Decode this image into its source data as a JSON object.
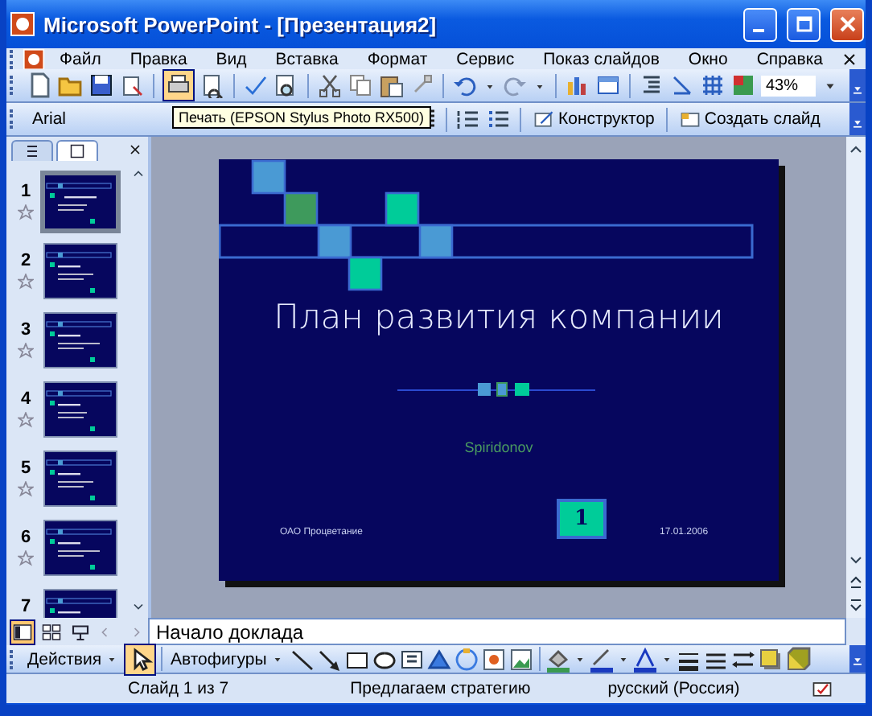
{
  "window": {
    "title": "Microsoft PowerPoint - [Презентация2]"
  },
  "menu": {
    "items": [
      "Файл",
      "Правка",
      "Вид",
      "Вставка",
      "Формат",
      "Сервис",
      "Показ слайдов",
      "Окно",
      "Справка"
    ]
  },
  "standard_toolbar": {
    "print_button": {
      "highlighted": true
    },
    "zoom": "43%"
  },
  "formatting_toolbar": {
    "font": "Arial",
    "buttons": [
      "Конструктор",
      "Создать слайд"
    ]
  },
  "tooltip": "Печать (EPSON Stylus Photo RX500)",
  "panel_tabs": [
    {
      "selected": false
    },
    {
      "selected": true
    }
  ],
  "slides": [
    {
      "number": "1",
      "selected": true
    },
    {
      "number": "2",
      "selected": false
    },
    {
      "number": "3",
      "selected": false
    },
    {
      "number": "4",
      "selected": false
    },
    {
      "number": "5",
      "selected": false
    },
    {
      "number": "6",
      "selected": false
    },
    {
      "number": "7",
      "selected": false
    }
  ],
  "slide": {
    "title": "План развития компании",
    "subtitle": "Spiridonov",
    "footer": "ОАО Процветание",
    "date": "17.01.2006",
    "number": "1"
  },
  "view_buttons": [
    {
      "selected": true
    },
    {
      "selected": false
    },
    {
      "selected": false
    }
  ],
  "notes": "Начало доклада",
  "drawing_toolbar": {
    "actions": "Действия",
    "select_button": {
      "highlighted": true
    },
    "autoshapes": "Автофигуры"
  },
  "status_bar": [
    "Слайд 1 из 7",
    "Предлагаем стратегию",
    "русский (Россия)"
  ]
}
